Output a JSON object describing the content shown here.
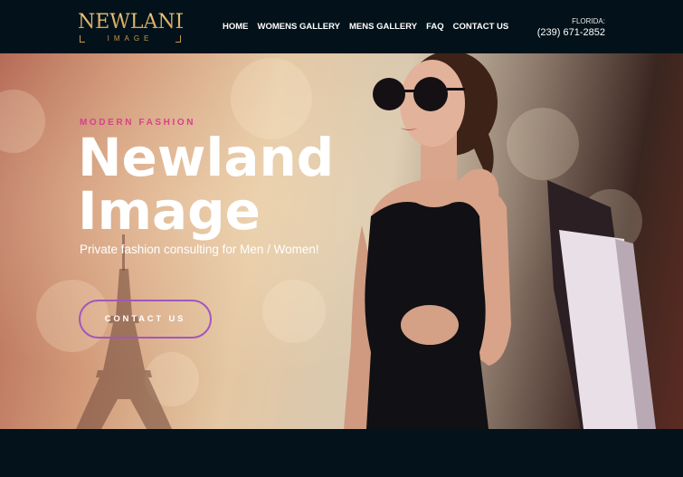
{
  "header": {
    "logo_main": "NEWLAND",
    "logo_sub": "IMAGE",
    "nav": [
      {
        "label": "HOME"
      },
      {
        "label": "WOMENS GALLERY"
      },
      {
        "label": "MENS GALLERY"
      },
      {
        "label": "FAQ"
      },
      {
        "label": "CONTACT US"
      }
    ],
    "contact_label": "FLORIDA:",
    "contact_phone": "(239) 671-2852"
  },
  "hero": {
    "eyebrow": "MODERN FASHION",
    "title": "Newland Image",
    "subtitle": "Private fashion consulting for Men / Women!",
    "button_label": "CONTACT US"
  },
  "colors": {
    "header_bg": "#03121a",
    "logo_gold": "#d4a85a",
    "eyebrow_pink": "#d6428a",
    "button_border": "#a157bd"
  }
}
